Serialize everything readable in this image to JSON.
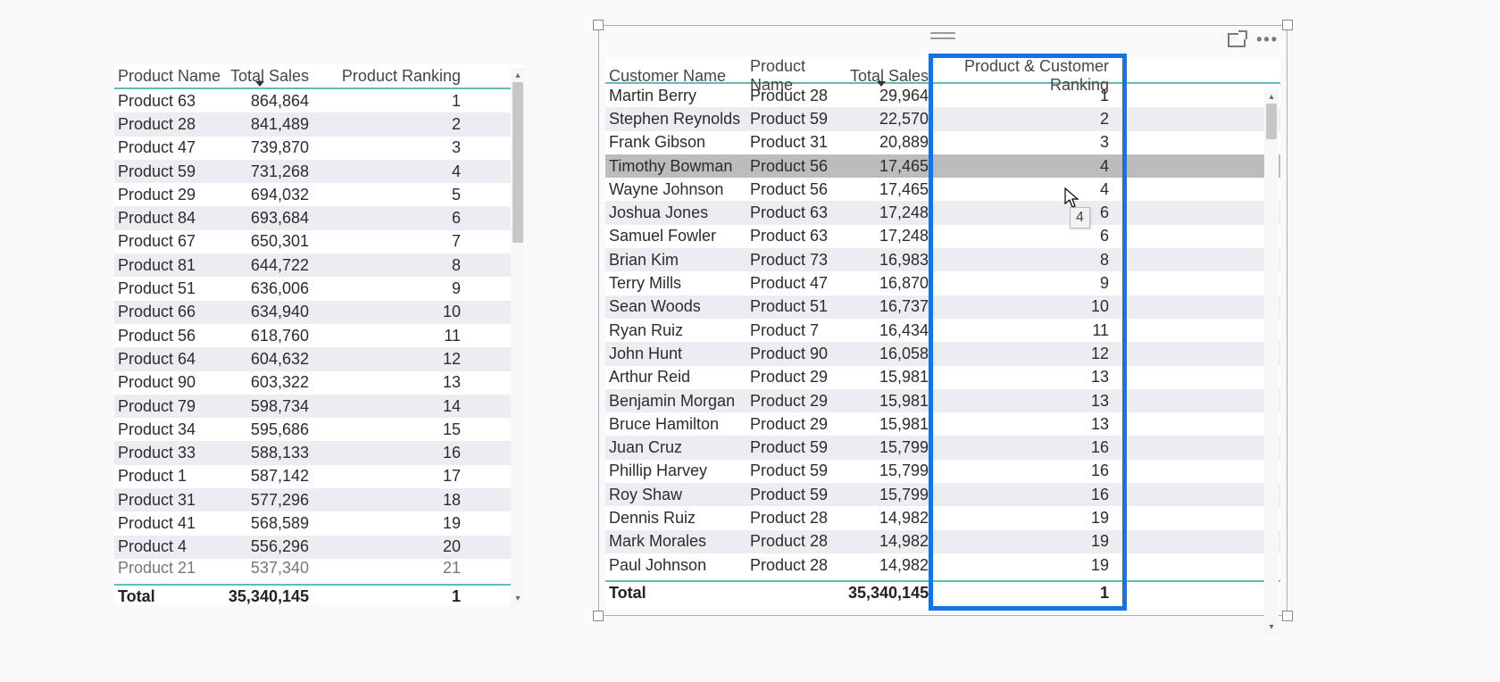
{
  "left_table": {
    "columns": [
      "Product Name",
      "Total Sales",
      "Product Ranking"
    ],
    "rows": [
      {
        "product": "Product 63",
        "sales": "864,864",
        "rank": "1"
      },
      {
        "product": "Product 28",
        "sales": "841,489",
        "rank": "2"
      },
      {
        "product": "Product 47",
        "sales": "739,870",
        "rank": "3"
      },
      {
        "product": "Product 59",
        "sales": "731,268",
        "rank": "4"
      },
      {
        "product": "Product 29",
        "sales": "694,032",
        "rank": "5"
      },
      {
        "product": "Product 84",
        "sales": "693,684",
        "rank": "6"
      },
      {
        "product": "Product 67",
        "sales": "650,301",
        "rank": "7"
      },
      {
        "product": "Product 81",
        "sales": "644,722",
        "rank": "8"
      },
      {
        "product": "Product 51",
        "sales": "636,006",
        "rank": "9"
      },
      {
        "product": "Product 66",
        "sales": "634,940",
        "rank": "10"
      },
      {
        "product": "Product 56",
        "sales": "618,760",
        "rank": "11"
      },
      {
        "product": "Product 64",
        "sales": "604,632",
        "rank": "12"
      },
      {
        "product": "Product 90",
        "sales": "603,322",
        "rank": "13"
      },
      {
        "product": "Product 79",
        "sales": "598,734",
        "rank": "14"
      },
      {
        "product": "Product 34",
        "sales": "595,686",
        "rank": "15"
      },
      {
        "product": "Product 33",
        "sales": "588,133",
        "rank": "16"
      },
      {
        "product": "Product 1",
        "sales": "587,142",
        "rank": "17"
      },
      {
        "product": "Product 31",
        "sales": "577,296",
        "rank": "18"
      },
      {
        "product": "Product 41",
        "sales": "568,589",
        "rank": "19"
      },
      {
        "product": "Product 4",
        "sales": "556,296",
        "rank": "20"
      },
      {
        "product": "Product 21",
        "sales": "537,340",
        "rank": "21"
      }
    ],
    "total": {
      "label": "Total",
      "sales": "35,340,145",
      "rank": "1"
    }
  },
  "right_table": {
    "columns": [
      "Customer Name",
      "Product Name",
      "Total Sales",
      "Product & Customer Ranking"
    ],
    "rows": [
      {
        "customer": "Martin Berry",
        "product": "Product 28",
        "sales": "29,964",
        "rank": "1"
      },
      {
        "customer": "Stephen Reynolds",
        "product": "Product 59",
        "sales": "22,570",
        "rank": "2"
      },
      {
        "customer": "Frank Gibson",
        "product": "Product 31",
        "sales": "20,889",
        "rank": "3"
      },
      {
        "customer": "Timothy Bowman",
        "product": "Product 56",
        "sales": "17,465",
        "rank": "4"
      },
      {
        "customer": "Wayne Johnson",
        "product": "Product 56",
        "sales": "17,465",
        "rank": "4"
      },
      {
        "customer": "Joshua Jones",
        "product": "Product 63",
        "sales": "17,248",
        "rank": "6"
      },
      {
        "customer": "Samuel Fowler",
        "product": "Product 63",
        "sales": "17,248",
        "rank": "6"
      },
      {
        "customer": "Brian Kim",
        "product": "Product 73",
        "sales": "16,983",
        "rank": "8"
      },
      {
        "customer": "Terry Mills",
        "product": "Product 47",
        "sales": "16,870",
        "rank": "9"
      },
      {
        "customer": "Sean Woods",
        "product": "Product 51",
        "sales": "16,737",
        "rank": "10"
      },
      {
        "customer": "Ryan Ruiz",
        "product": "Product 7",
        "sales": "16,434",
        "rank": "11"
      },
      {
        "customer": "John Hunt",
        "product": "Product 90",
        "sales": "16,058",
        "rank": "12"
      },
      {
        "customer": "Arthur Reid",
        "product": "Product 29",
        "sales": "15,981",
        "rank": "13"
      },
      {
        "customer": "Benjamin Morgan",
        "product": "Product 29",
        "sales": "15,981",
        "rank": "13"
      },
      {
        "customer": "Bruce Hamilton",
        "product": "Product 29",
        "sales": "15,981",
        "rank": "13"
      },
      {
        "customer": "Juan Cruz",
        "product": "Product 59",
        "sales": "15,799",
        "rank": "16"
      },
      {
        "customer": "Phillip Harvey",
        "product": "Product 59",
        "sales": "15,799",
        "rank": "16"
      },
      {
        "customer": "Roy Shaw",
        "product": "Product 59",
        "sales": "15,799",
        "rank": "16"
      },
      {
        "customer": "Dennis Ruiz",
        "product": "Product 28",
        "sales": "14,982",
        "rank": "19"
      },
      {
        "customer": "Mark Morales",
        "product": "Product 28",
        "sales": "14,982",
        "rank": "19"
      },
      {
        "customer": "Paul Johnson",
        "product": "Product 28",
        "sales": "14,982",
        "rank": "19"
      }
    ],
    "total": {
      "label": "Total",
      "sales": "35,340,145",
      "rank": "1"
    },
    "hover_row_index": 3,
    "tooltip_value": "4"
  }
}
